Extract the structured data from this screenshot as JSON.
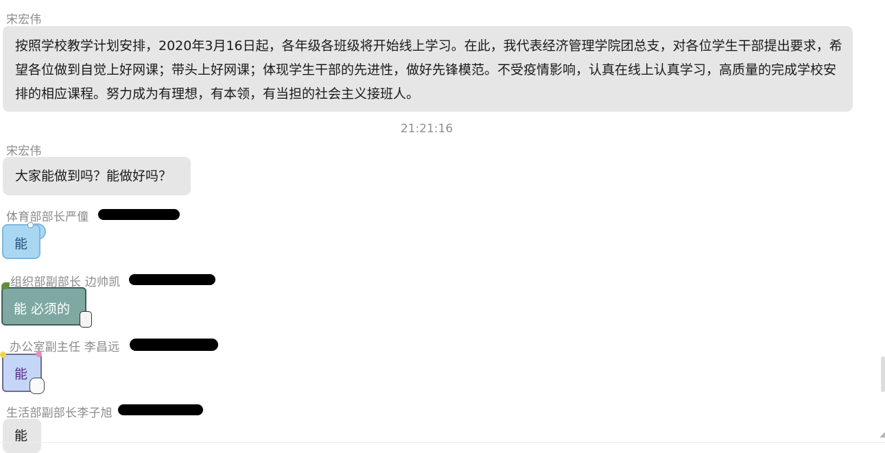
{
  "messages": [
    {
      "sender": "宋宏伟",
      "text": "按照学校教学计划安排，2020年3月16日起，各年级各班级将开始线上学习。在此，我代表经济管理学院团总支，对各位学生干部提出要求，希望各位做到自觉上好网课；带头上好网课；体现学生干部的先进性，做好先锋模范。不受疫情影响，认真在线上认真学习，高质量的完成学校安排的相应课程。努力成为有理想，有本领，有当担的社会主义接班人。"
    },
    {
      "timestamp": "21:21:16"
    },
    {
      "sender": "宋宏伟",
      "text": "大家能做到吗？能做好吗？"
    },
    {
      "sender": "体育部部长严僮",
      "text": "能"
    },
    {
      "sender": "组织部副部长 边帅凯",
      "text": "能 必须的"
    },
    {
      "sender": "办公室副主任 李昌远",
      "text": "能"
    },
    {
      "sender": "生活部副部长李子旭",
      "text": "能"
    }
  ],
  "colors": {
    "bubble_default": "#e6e6e6",
    "bubble_blue": "#a9d7f2",
    "bubble_teal": "#7fa8a2",
    "bubble_purple": "#c3d6f6",
    "sender_text": "#8a8a8a"
  }
}
